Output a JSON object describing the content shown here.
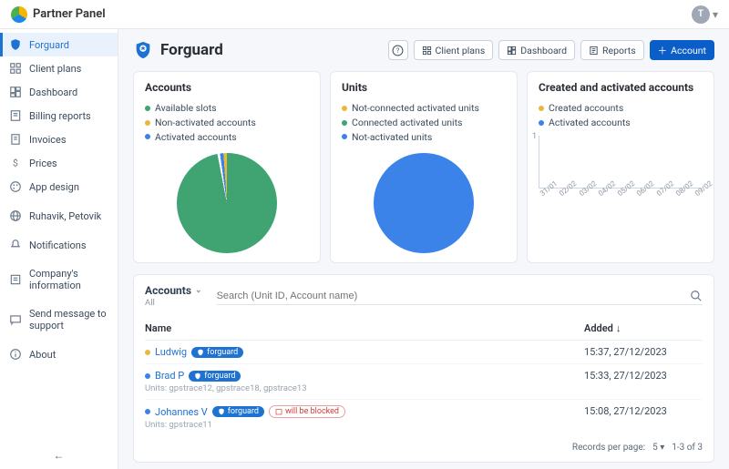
{
  "app_name": "Partner Panel",
  "avatar_initial": "T",
  "sidebar": [
    {
      "label": "Forguard",
      "icon": "shield",
      "active": true
    },
    {
      "label": "Client plans",
      "icon": "grid"
    },
    {
      "label": "Dashboard",
      "icon": "dashboard"
    },
    {
      "label": "Billing reports",
      "icon": "report"
    },
    {
      "label": "Invoices",
      "icon": "invoice"
    },
    {
      "label": "Prices",
      "icon": "dollar"
    },
    {
      "label": "App design",
      "icon": "palette"
    },
    {
      "spacer": true
    },
    {
      "label": "Ruhavik, Petovik",
      "icon": "globe"
    },
    {
      "spacer": true
    },
    {
      "label": "Notifications",
      "icon": "bell"
    },
    {
      "spacer": true
    },
    {
      "label": "Company's information",
      "icon": "info"
    },
    {
      "spacer": true
    },
    {
      "label": "Send message to support",
      "icon": "message"
    },
    {
      "spacer": true
    },
    {
      "label": "About",
      "icon": "about"
    }
  ],
  "page_title": "Forguard",
  "head_buttons": {
    "client_plans": "Client plans",
    "dashboard": "Dashboard",
    "reports": "Reports",
    "account": "Account"
  },
  "cards": {
    "accounts": {
      "title": "Accounts",
      "legend": [
        {
          "label": "Available slots",
          "color": "#3fa372"
        },
        {
          "label": "Non-activated accounts",
          "color": "#e9b93b"
        },
        {
          "label": "Activated accounts",
          "color": "#3b82e9"
        }
      ]
    },
    "units": {
      "title": "Units",
      "legend": [
        {
          "label": "Not-connected activated units",
          "color": "#e9b93b"
        },
        {
          "label": "Connected activated units",
          "color": "#3fa372"
        },
        {
          "label": "Not-activated units",
          "color": "#3b82e9"
        }
      ]
    },
    "created": {
      "title": "Created and activated accounts",
      "legend": [
        {
          "label": "Created accounts",
          "color": "#e9b93b"
        },
        {
          "label": "Activated accounts",
          "color": "#3b82e9"
        }
      ],
      "ymax": "1",
      "xticks": [
        "31/01",
        "02/02",
        "03/02",
        "04/02",
        "05/02",
        "06/02",
        "07/02",
        "08/02",
        "09/02"
      ]
    }
  },
  "chart_data": [
    {
      "type": "pie",
      "title": "Accounts",
      "series": [
        {
          "name": "Available slots",
          "value": 97,
          "color": "#3fa372"
        },
        {
          "name": "Non-activated accounts",
          "value": 1,
          "color": "#e9b93b"
        },
        {
          "name": "Activated accounts",
          "value": 2,
          "color": "#3b82e9"
        }
      ]
    },
    {
      "type": "pie",
      "title": "Units",
      "series": [
        {
          "name": "Not-connected activated units",
          "value": 0,
          "color": "#e9b93b"
        },
        {
          "name": "Connected activated units",
          "value": 0,
          "color": "#3fa372"
        },
        {
          "name": "Not-activated units",
          "value": 100,
          "color": "#3b82e9"
        }
      ]
    },
    {
      "type": "line",
      "title": "Created and activated accounts",
      "x": [
        "31/01",
        "02/02",
        "03/02",
        "04/02",
        "05/02",
        "06/02",
        "07/02",
        "08/02",
        "09/02"
      ],
      "ylim": [
        0,
        1
      ],
      "series": [
        {
          "name": "Created accounts",
          "values": [
            0,
            0,
            0,
            0,
            0,
            0,
            0,
            0,
            0
          ],
          "color": "#e9b93b"
        },
        {
          "name": "Activated accounts",
          "values": [
            0,
            0,
            0,
            0,
            0,
            0,
            0,
            0,
            0
          ],
          "color": "#3b82e9"
        }
      ]
    }
  ],
  "table": {
    "title": "Accounts",
    "subtitle": "All",
    "search_placeholder": "Search (Unit ID, Account name)",
    "columns": {
      "name": "Name",
      "added": "Added"
    },
    "rows": [
      {
        "status": "#e9b93b",
        "name": "Ludwig",
        "badge": "forguard",
        "sub": "",
        "added": "15:37, 27/12/2023"
      },
      {
        "status": "#3b82e9",
        "name": "Brad P",
        "badge": "forguard",
        "sub": "Units: gpstrace12, gpstrace18, gpstrace13",
        "added": "15:33, 27/12/2023"
      },
      {
        "status": "#3b82e9",
        "name": "Johannes V",
        "badge": "forguard",
        "warn": "will be blocked",
        "sub": "Units: gpstrace11",
        "added": "15:08, 27/12/2023"
      }
    ],
    "pager": {
      "rows_label": "Records per page:",
      "rows_value": "5",
      "range": "1-3 of 3"
    }
  }
}
